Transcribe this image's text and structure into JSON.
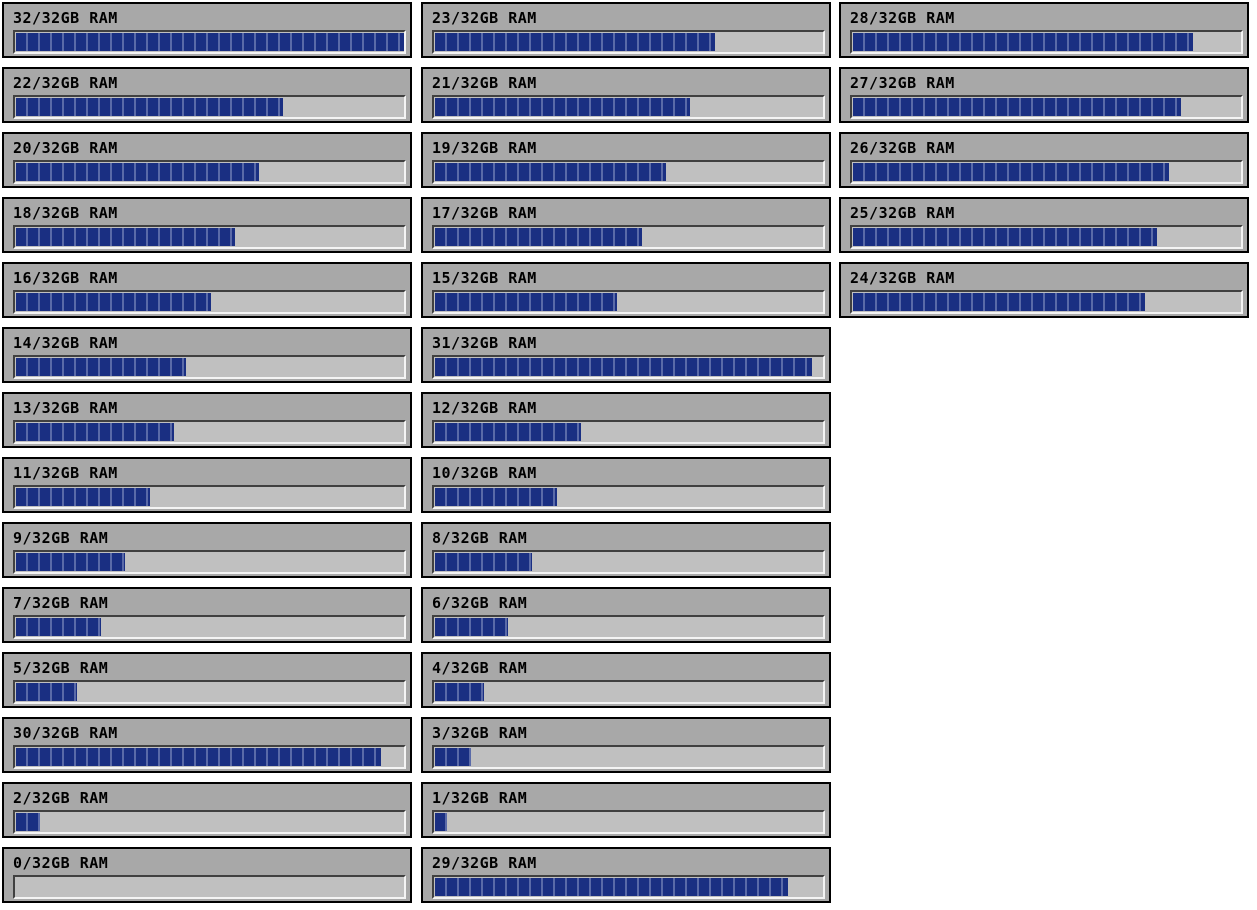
{
  "capacity_gb": 32,
  "colors": {
    "panel_bg": "#a8a8a8",
    "track_bg": "#c0c0c0",
    "fill": "#1a2f82",
    "segment_gap": "#5a6aa8",
    "border": "#000000"
  },
  "columns": [
    {
      "meters": [
        {
          "label": "32/32GB RAM",
          "used_gb": 32
        },
        {
          "label": "22/32GB RAM",
          "used_gb": 22
        },
        {
          "label": "20/32GB RAM",
          "used_gb": 20
        },
        {
          "label": "18/32GB RAM",
          "used_gb": 18
        },
        {
          "label": "16/32GB RAM",
          "used_gb": 16
        },
        {
          "label": "14/32GB RAM",
          "used_gb": 14
        },
        {
          "label": "13/32GB RAM",
          "used_gb": 13
        },
        {
          "label": "11/32GB RAM",
          "used_gb": 11
        },
        {
          "label": "9/32GB RAM",
          "used_gb": 9
        },
        {
          "label": "7/32GB RAM",
          "used_gb": 7
        },
        {
          "label": "5/32GB RAM",
          "used_gb": 5
        },
        {
          "label": "30/32GB RAM",
          "used_gb": 30
        },
        {
          "label": "2/32GB RAM",
          "used_gb": 2
        },
        {
          "label": "0/32GB RAM",
          "used_gb": 0
        }
      ]
    },
    {
      "meters": [
        {
          "label": "23/32GB RAM",
          "used_gb": 23
        },
        {
          "label": "21/32GB RAM",
          "used_gb": 21
        },
        {
          "label": "19/32GB RAM",
          "used_gb": 19
        },
        {
          "label": "17/32GB RAM",
          "used_gb": 17
        },
        {
          "label": "15/32GB RAM",
          "used_gb": 15
        },
        {
          "label": "31/32GB RAM",
          "used_gb": 31
        },
        {
          "label": "12/32GB RAM",
          "used_gb": 12
        },
        {
          "label": "10/32GB RAM",
          "used_gb": 10
        },
        {
          "label": "8/32GB RAM",
          "used_gb": 8
        },
        {
          "label": "6/32GB RAM",
          "used_gb": 6
        },
        {
          "label": "4/32GB RAM",
          "used_gb": 4
        },
        {
          "label": "3/32GB RAM",
          "used_gb": 3
        },
        {
          "label": "1/32GB RAM",
          "used_gb": 1
        },
        {
          "label": "29/32GB RAM",
          "used_gb": 29
        }
      ]
    },
    {
      "meters": [
        {
          "label": "28/32GB RAM",
          "used_gb": 28
        },
        {
          "label": "27/32GB RAM",
          "used_gb": 27
        },
        {
          "label": "26/32GB RAM",
          "used_gb": 26
        },
        {
          "label": "25/32GB RAM",
          "used_gb": 25
        },
        {
          "label": "24/32GB RAM",
          "used_gb": 24
        }
      ]
    }
  ]
}
